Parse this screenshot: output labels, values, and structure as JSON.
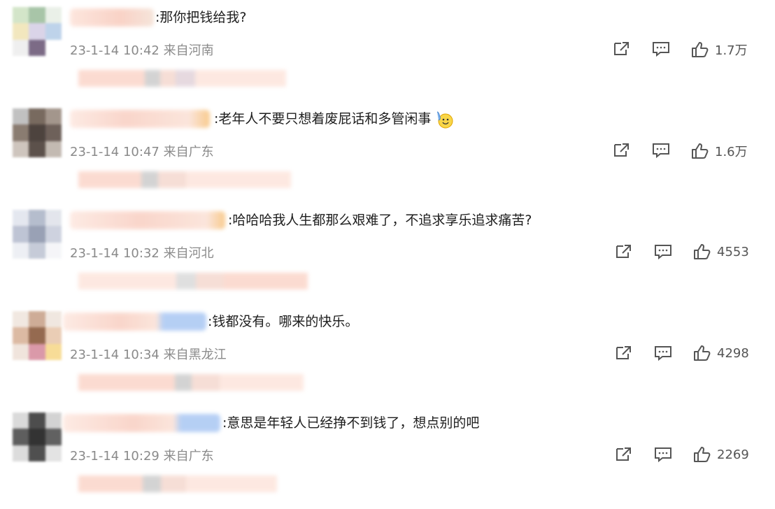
{
  "comments": [
    {
      "text": ":那你把钱给我?",
      "time": "23-1-14 10:42",
      "location": "来自河南",
      "likes": "1.7万",
      "has_emoji": false
    },
    {
      "text": ":老年人不要只想着废屁话和多管闲事",
      "time": "23-1-14 10:47",
      "location": "来自广东",
      "likes": "1.6万",
      "has_emoji": true
    },
    {
      "text": ":哈哈哈我人生都那么艰难了，不追求享乐追求痛苦?",
      "time": "23-1-14 10:32",
      "location": "来自河北",
      "likes": "4553",
      "has_emoji": false
    },
    {
      "text": ":钱都没有。哪来的快乐。",
      "time": "23-1-14 10:34",
      "location": "来自黑龙江",
      "likes": "4298",
      "has_emoji": false
    },
    {
      "text": ":意思是年轻人已经挣不到钱了，想点别的吧",
      "time": "23-1-14 10:29",
      "location": "来自广东",
      "likes": "2269",
      "has_emoji": false
    }
  ],
  "icons": {
    "share": "share-icon",
    "comment": "comment-icon",
    "like": "thumbs-up-icon"
  },
  "colors": {
    "meta_text": "#8a8a8a",
    "icon_stroke": "#555555",
    "blur_pink": "#f9c9bd",
    "blur_blue": "#a9c7f3",
    "blur_orange": "#f7c27a"
  }
}
